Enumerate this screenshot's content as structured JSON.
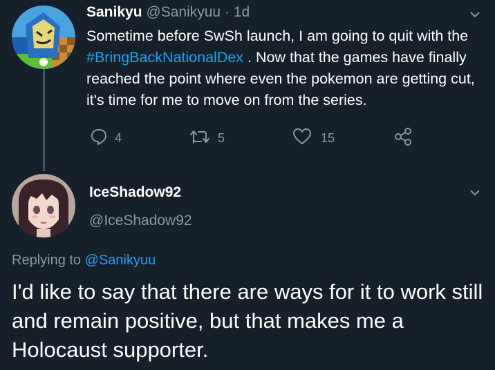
{
  "tweet1": {
    "name": "Sanikyu",
    "handle": "@Sanikyuu",
    "separator": "·",
    "time": "1d",
    "text_before": "Sometime before SwSh launch, I am going to quit with the ",
    "hashtag": "#BringBackNationalDex",
    "text_after": " . Now that the games have finally reached the point where even the pokemon are getting cut, it's time for me to move on from the series.",
    "replies": "4",
    "retweets": "5",
    "likes": "15"
  },
  "tweet2": {
    "name": "IceShadow92",
    "handle": "@IceShadow92",
    "replying_prefix": "Replying to ",
    "replying_to": "@Sanikyuu",
    "text": "I'd like to say that there are ways for it to work still and remain positive, but that makes me a Holocaust supporter."
  },
  "colors": {
    "background": "#15202b",
    "muted": "#8899a6",
    "link": "#1da1f2",
    "thread_line": "#3d5466"
  },
  "icons": [
    "chevron-down-icon",
    "reply-icon",
    "retweet-icon",
    "like-icon",
    "share-icon"
  ]
}
